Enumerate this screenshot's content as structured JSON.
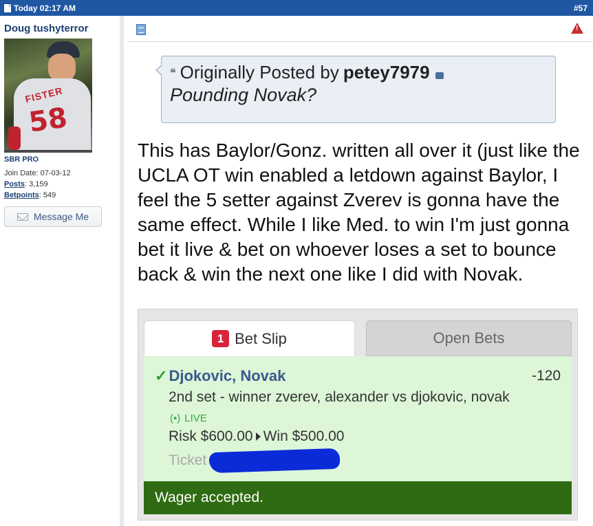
{
  "header": {
    "timestamp": "Today 02:17 AM",
    "post_number": "#57"
  },
  "user": {
    "username": "Doug tushyterror",
    "avatar_jersey_name": "FISTER",
    "avatar_jersey_number": "58",
    "rank": "SBR PRO",
    "join_label": "Join Date:",
    "join_date": "07-03-12",
    "posts_label": "Posts",
    "posts": "3,159",
    "betpoints_label": "Betpoints",
    "betpoints": "549",
    "message_button": "Message Me"
  },
  "quote": {
    "prefix": "Originally Posted by",
    "poster": "petey7979",
    "text": "Pounding Novak?"
  },
  "body": {
    "text": "This has Baylor/Gonz. written all over it (just like the UCLA OT win enabled a letdown against Baylor, I feel the 5 setter against Zverev is gonna have the same effect. While I like Med. to win I'm just gonna bet it live & bet on whoever loses a set to bounce back & win the next one like I did with Novak."
  },
  "bet_slip": {
    "tab_count": "1",
    "tab_bet_slip": "Bet Slip",
    "tab_open_bets": "Open Bets",
    "selection": "Djokovic, Novak",
    "odds": "-120",
    "market": "2nd set - winner zverev, alexander vs djokovic, novak",
    "live_label": "LIVE",
    "risk": "Risk $600.00",
    "win": "Win $500.00",
    "ticket_label": "Ticket",
    "status": "Wager accepted."
  },
  "colors": {
    "header_bg": "#1f57a3",
    "accepted_bg": "#2f6b12",
    "slip_bg": "#dcf6d7",
    "badge": "#d8243a"
  }
}
